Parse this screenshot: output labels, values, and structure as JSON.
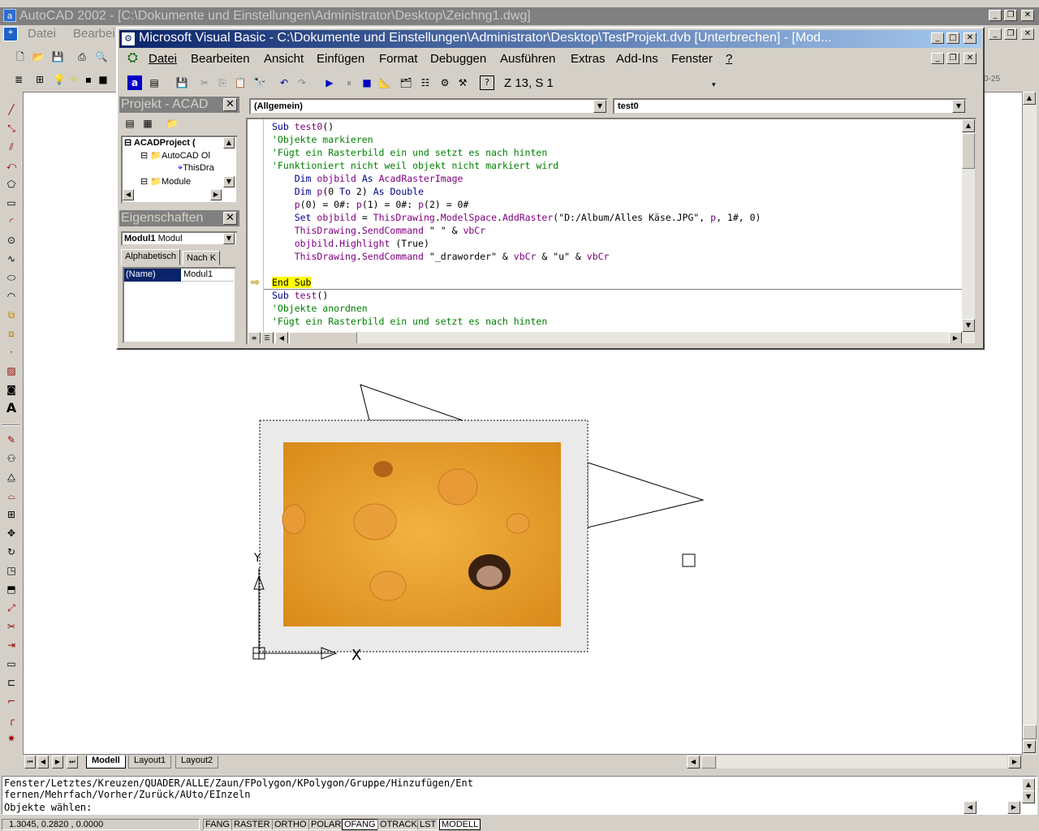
{
  "autocad": {
    "title": "AutoCAD 2002 - [C:\\Dokumente und Einstellungen\\Administrator\\Desktop\\Zeichng1.dwg]",
    "menu": [
      "Datei",
      "Bearbei"
    ],
    "right_text": "0-25",
    "tabs": [
      "Modell",
      "Layout1",
      "Layout2"
    ],
    "command_lines": [
      "Fenster/Letztes/Kreuzen/QUADER/ALLE/Zaun/FPolygon/KPolygon/Gruppe/Hinzufügen/Ent",
      "fernen/Mehrfach/Vorher/Zurück/AUto/EInzeln",
      "Objekte wählen:"
    ],
    "coords": "1.3045, 0.2820 , 0.0000",
    "status": [
      "FANG",
      "RASTER",
      "ORTHO",
      "POLAR",
      "OFANG",
      "OTRACK",
      "LST",
      "MODELL"
    ]
  },
  "vba": {
    "title": "Microsoft Visual Basic - C:\\Dokumente und Einstellungen\\Administrator\\Desktop\\TestProjekt.dvb [Unterbrechen] - [Mod...",
    "menu": [
      "Datei",
      "Bearbeiten",
      "Ansicht",
      "Einfügen",
      "Format",
      "Debuggen",
      "Ausführen",
      "Extras",
      "Add-Ins",
      "Fenster",
      "?"
    ],
    "position": "Z 13, S 1",
    "project_title": "Projekt - ACAD",
    "tree": [
      "ACADProject (",
      "AutoCAD Ol",
      "ThisDra",
      "Module"
    ],
    "props_title": "Eigenschaften",
    "props_object": "Modul1",
    "props_type": "Modul",
    "props_tabs": [
      "Alphabetisch",
      "Nach K"
    ],
    "prop_name": "(Name)",
    "prop_value": "Modul1",
    "object_combo": "(Allgemein)",
    "proc_combo": "test0",
    "code": [
      "Sub test0()",
      "'Objekte markieren",
      "'Fügt ein Rasterbild ein und setzt es nach hinten",
      "'Funktioniert nicht weil objekt nicht markiert wird",
      "    Dim objbild As AcadRasterImage",
      "    Dim p(0 To 2) As Double",
      "    p(0) = 0#: p(1) = 0#: p(2) = 0#",
      "    Set objbild = ThisDrawing.ModelSpace.AddRaster(\"D:/Album/Alles Käse.JPG\", p, 1#, 0)",
      "    ThisDrawing.SendCommand \" \" & vbCr",
      "    objbild.Highlight (True)",
      "    ThisDrawing.SendCommand \"_draworder\" & vbCr & \"u\" & vbCr",
      "",
      "End Sub",
      "Sub test()",
      "'Objekte anordnen",
      "'Fügt ein Rasterbild ein und setzt es nach hinten"
    ]
  }
}
